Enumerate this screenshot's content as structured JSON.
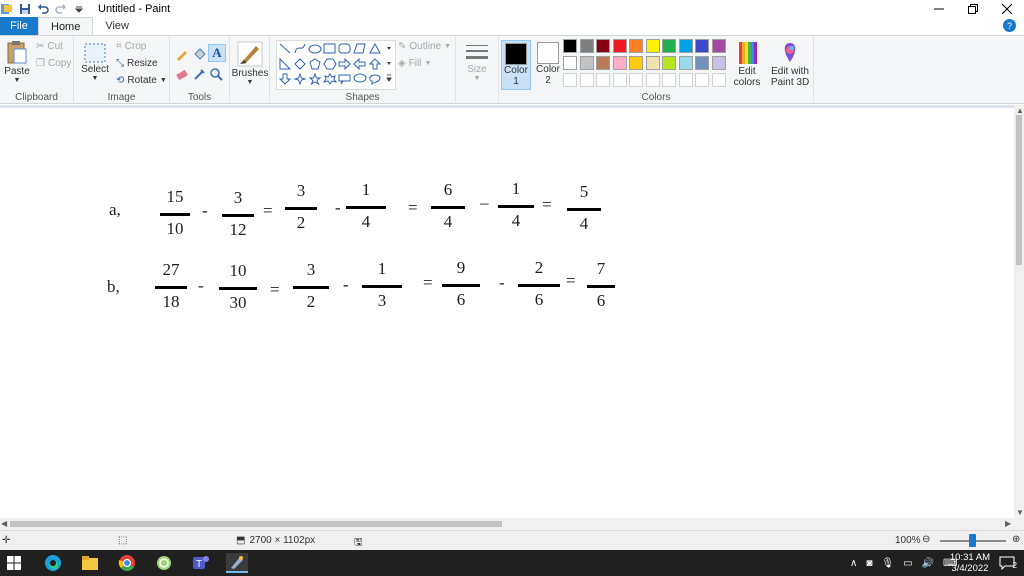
{
  "window": {
    "title": "Untitled - Paint"
  },
  "tabs": [
    {
      "label": "File"
    },
    {
      "label": "Home"
    },
    {
      "label": "View"
    }
  ],
  "ribbon": {
    "clipboard": {
      "group_label": "Clipboard",
      "paste": "Paste",
      "cut": "Cut",
      "copy": "Copy"
    },
    "image": {
      "group_label": "Image",
      "select": "Select",
      "crop": "Crop",
      "resize": "Resize",
      "rotate": "Rotate"
    },
    "tools": {
      "group_label": "Tools"
    },
    "brushes": {
      "label": "Brushes"
    },
    "shapes": {
      "group_label": "Shapes",
      "outline": "Outline",
      "fill": "Fill"
    },
    "size": {
      "label": "Size"
    },
    "color1": {
      "label_line1": "Color",
      "label_line2": "1",
      "value": "#000000"
    },
    "color2": {
      "label_line1": "Color",
      "label_line2": "2",
      "value": "#ffffff"
    },
    "colors": {
      "group_label": "Colors",
      "edit_colors_line1": "Edit",
      "edit_colors_line2": "colors",
      "edit_3d_line1": "Edit with",
      "edit_3d_line2": "Paint 3D"
    },
    "palette_row1": [
      "#000000",
      "#7f7f7f",
      "#880015",
      "#ed1c24",
      "#ff7f27",
      "#fff200",
      "#22b14c",
      "#00a2e8",
      "#3f48cc",
      "#a349a4"
    ],
    "palette_row2": [
      "#ffffff",
      "#c3c3c3",
      "#b97a57",
      "#ffaec9",
      "#ffc90e",
      "#efe4b0",
      "#b5e61d",
      "#99d9ea",
      "#7092be",
      "#c8bfe7"
    ]
  },
  "canvas": {
    "row_a": {
      "label": "a,",
      "fractions": [
        {
          "num": "15",
          "den": "10"
        },
        {
          "num": "3",
          "den": "12"
        },
        {
          "num": "3",
          "den": "2"
        },
        {
          "num": "1",
          "den": "4"
        },
        {
          "num": "6",
          "den": "4"
        },
        {
          "num": "1",
          "den": "4"
        },
        {
          "num": "5",
          "den": "4"
        }
      ],
      "ops": [
        "-",
        "=",
        "-",
        "=",
        "–",
        "="
      ]
    },
    "row_b": {
      "label": "b,",
      "fractions": [
        {
          "num": "27",
          "den": "18"
        },
        {
          "num": "10",
          "den": "30"
        },
        {
          "num": "3",
          "den": "2"
        },
        {
          "num": "1",
          "den": "3"
        },
        {
          "num": "9",
          "den": "6"
        },
        {
          "num": "2",
          "den": "6"
        },
        {
          "num": "7",
          "den": "6"
        }
      ],
      "ops": [
        "-",
        "=",
        "-",
        "=",
        "-",
        "="
      ]
    }
  },
  "statusbar": {
    "dimensions": "2700 × 1102px",
    "zoom": "100%"
  },
  "taskbar": {
    "time": "10:31 AM",
    "date": "3/4/2022",
    "notifications": "2"
  }
}
